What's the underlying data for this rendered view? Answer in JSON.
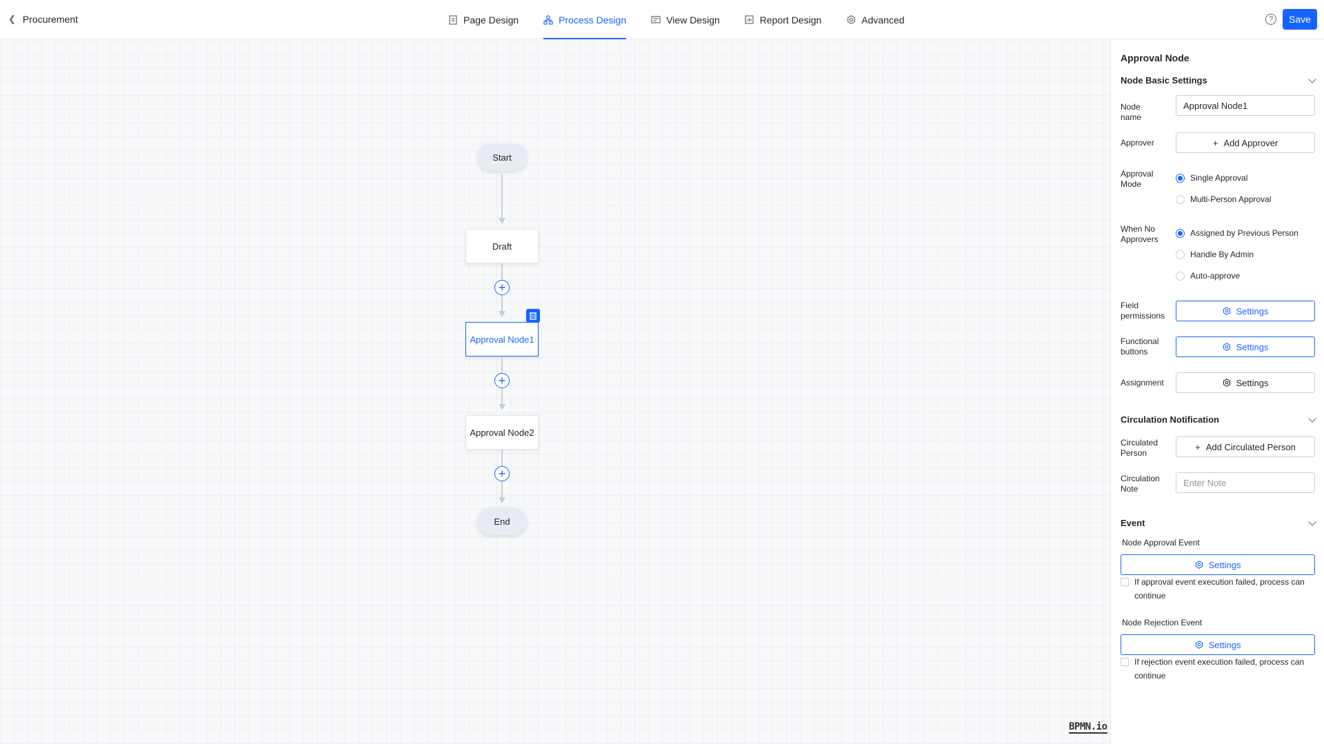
{
  "header": {
    "back_label": "Procurement",
    "tabs": [
      {
        "label": "Page Design",
        "icon": "page-icon",
        "active": false
      },
      {
        "label": "Process Design",
        "icon": "process-icon",
        "active": true
      },
      {
        "label": "View Design",
        "icon": "view-icon",
        "active": false
      },
      {
        "label": "Report Design",
        "icon": "report-icon",
        "active": false
      },
      {
        "label": "Advanced",
        "icon": "gear-icon",
        "active": false
      }
    ],
    "help_icon": "?",
    "save_label": "Save"
  },
  "flow": {
    "start": "Start",
    "draft": "Draft",
    "approval1": "Approval Node1",
    "approval2": "Approval Node2",
    "end": "End",
    "watermark": "BPMN.io"
  },
  "panel": {
    "title": "Approval Node",
    "basic": {
      "section": "Node Basic Settings",
      "node_name_label": "Node name",
      "node_name_value": "Approval Node1",
      "approver_label": "Approver",
      "add_approver": "Add Approver",
      "approval_mode_label": "Approval Mode",
      "approval_modes": [
        "Single Approval",
        "Multi-Person Approval"
      ],
      "approval_mode_selected": "Single Approval",
      "no_approvers_label": "When No Approvers",
      "no_approvers_options": [
        "Assigned by Previous Person",
        "Handle By Admin",
        "Auto-approve"
      ],
      "no_approvers_selected": "Assigned by Previous Person",
      "field_permissions_label": "Field permissions",
      "functional_buttons_label": "Functional buttons",
      "assignment_label": "Assignment",
      "settings_label": "Settings"
    },
    "circulation": {
      "section": "Circulation Notification",
      "person_label": "Circulated Person",
      "add_person": "Add Circulated Person",
      "note_label": "Circulation Note",
      "note_placeholder": "Enter Note"
    },
    "event": {
      "section": "Event",
      "approval_event_label": "Node Approval Event",
      "approval_settings": "Settings",
      "approval_continue": "If approval event execution failed, process can continue",
      "rejection_event_label": "Node Rejection Event",
      "rejection_settings": "Settings",
      "rejection_continue": "If rejection event execution failed, process can continue"
    }
  },
  "colors": {
    "accent": "#1664ff",
    "border": "#c9cdd4",
    "canvas": "#f7f8fa"
  }
}
